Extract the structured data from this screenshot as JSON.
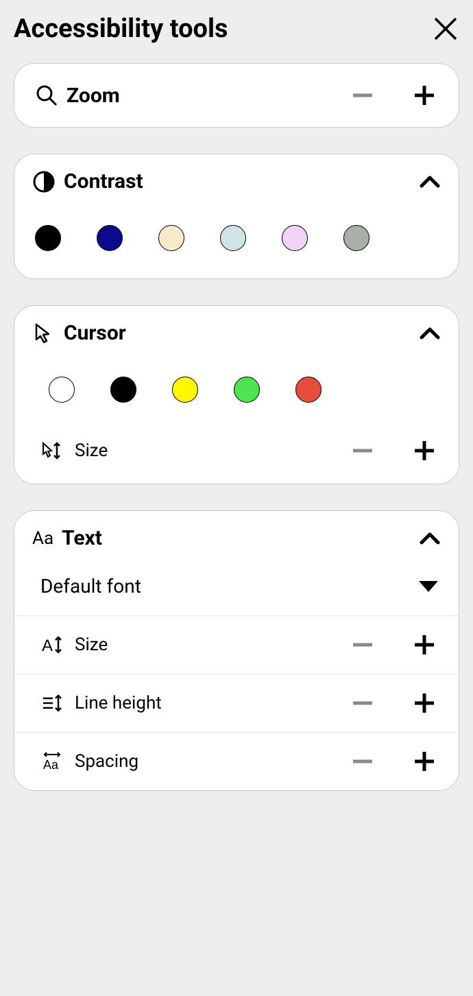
{
  "title": "Accessibility tools",
  "zoom": {
    "label": "Zoom"
  },
  "contrast": {
    "label": "Contrast",
    "swatches": [
      "#000000",
      "#0a0a8c",
      "#f5ebc8",
      "#cfe2e4",
      "#eed5f5",
      "#a8b0a8"
    ]
  },
  "cursor": {
    "label": "Cursor",
    "swatches": [
      "#ffffff",
      "#000000",
      "#fff700",
      "#4fe34f",
      "#e74c3c"
    ],
    "size_label": "Size"
  },
  "text": {
    "label": "Text",
    "font_label": "Default font",
    "size_label": "Size",
    "line_height_label": "Line height",
    "spacing_label": "Spacing"
  }
}
